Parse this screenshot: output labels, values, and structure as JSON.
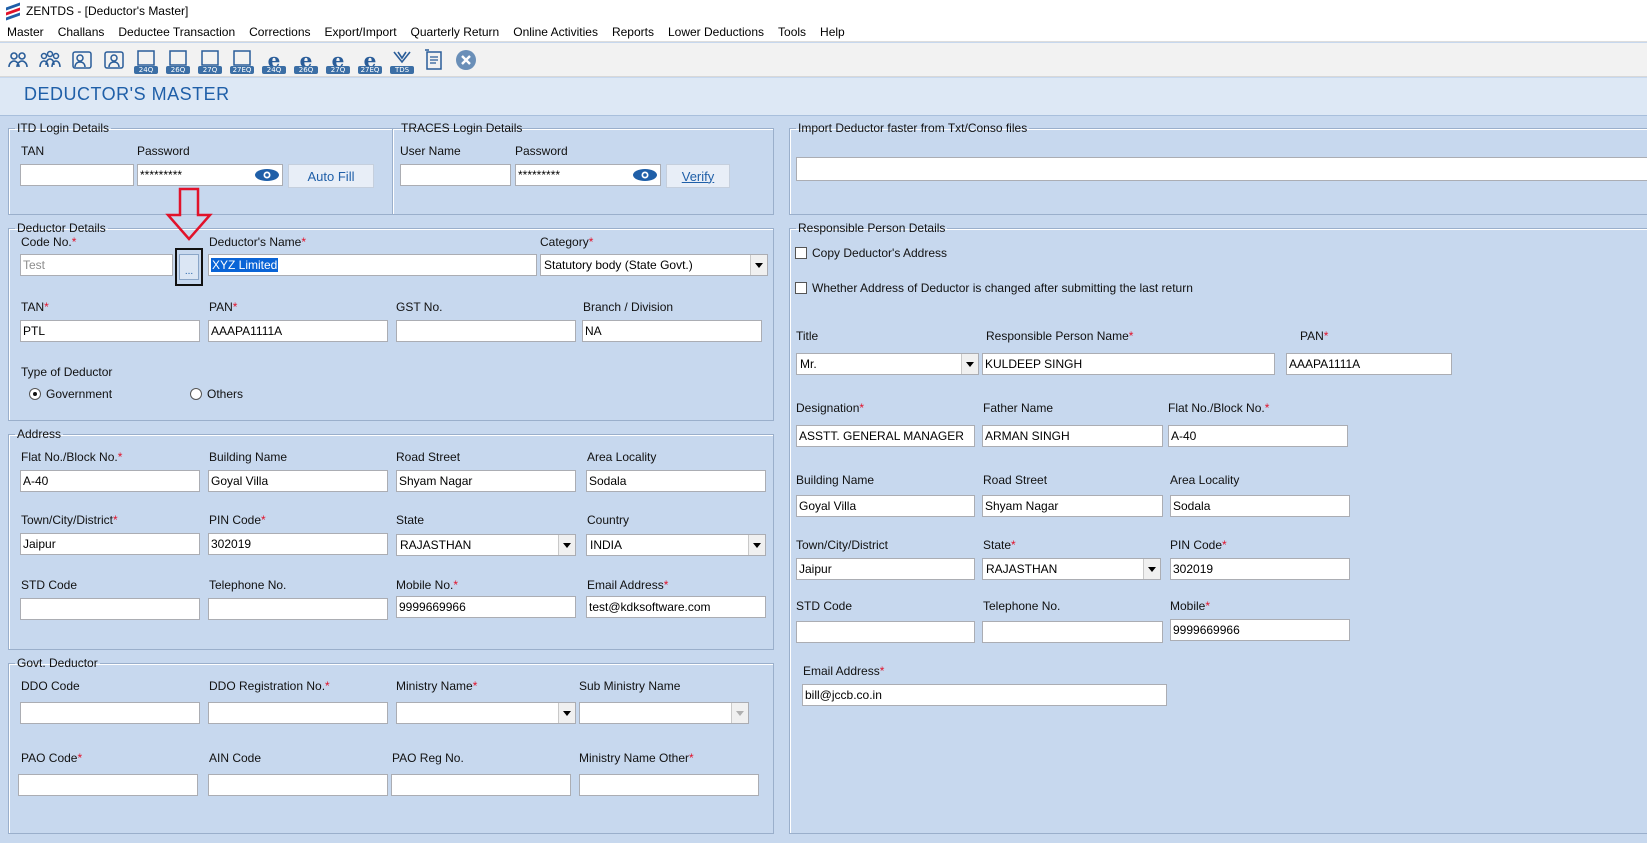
{
  "window": {
    "title": "ZENTDS - [Deductor's Master]"
  },
  "menu": [
    "Master",
    "Challans",
    "Deductee Transaction",
    "Corrections",
    "Export/Import",
    "Quarterly Return",
    "Online Activities",
    "Reports",
    "Lower Deductions",
    "Tools",
    "Help"
  ],
  "toolbar": {
    "icons": [
      "deductor-icon",
      "deductee-icon",
      "user-icon",
      "user2-icon",
      "24q-form-icon",
      "26q-form-icon",
      "27q-form-icon",
      "27eq-form-icon",
      "e-24q-icon",
      "e-26q-icon",
      "e-27q-icon",
      "e-27eq-icon",
      "tds-icon",
      "report-icon",
      "close-icon"
    ],
    "captions": [
      "",
      "",
      "",
      "",
      "24Q",
      "26Q",
      "27Q",
      "27EQ",
      "24Q",
      "26Q",
      "27Q",
      "27EQ",
      "TDS",
      "",
      ""
    ]
  },
  "page_title": "DEDUCTOR'S MASTER",
  "itd": {
    "legend": "ITD Login Details",
    "tan_label": "TAN",
    "tan_value": "",
    "password_label": "Password",
    "password_value": "*********",
    "autofill_label": "Auto Fill"
  },
  "traces": {
    "legend": "TRACES Login Details",
    "user_label": "User Name",
    "user_value": "",
    "password_label": "Password",
    "password_value": "*********",
    "verify_label": "Verify"
  },
  "import": {
    "legend": "Import Deductor faster from Txt/Conso files",
    "value": ""
  },
  "deductor": {
    "legend": "Deductor Details",
    "code_label": "Code No.",
    "code_value": "Test",
    "browse_label": "...",
    "name_label": "Deductor's Name",
    "name_value": "XYZ Limited",
    "category_label": "Category",
    "category_value": "Statutory body (State Govt.)",
    "tan_label": "TAN",
    "tan_value": "PTL",
    "pan_label": "PAN",
    "pan_value": "AAAPA1111A",
    "gst_label": "GST No.",
    "gst_value": "",
    "branch_label": "Branch / Division",
    "branch_value": "NA",
    "type_label": "Type of Deductor",
    "type_government": "Government",
    "type_others": "Others"
  },
  "address": {
    "legend": "Address",
    "flat_label": "Flat No./Block No.",
    "flat_value": "A-40",
    "building_label": "Building Name",
    "building_value": "Goyal Villa",
    "road_label": "Road Street",
    "road_value": "Shyam Nagar",
    "area_label": "Area Locality",
    "area_value": "Sodala",
    "town_label": "Town/City/District",
    "town_value": "Jaipur",
    "pin_label": "PIN Code",
    "pin_value": "302019",
    "state_label": "State",
    "state_value": "RAJASTHAN",
    "country_label": "Country",
    "country_value": "INDIA",
    "std_label": "STD Code",
    "std_value": "",
    "tel_label": "Telephone No.",
    "tel_value": "",
    "mobile_label": "Mobile No.",
    "mobile_value": "9999669966",
    "email_label": "Email Address",
    "email_value": "test@kdksoftware.com"
  },
  "govt": {
    "legend": "Govt. Deductor",
    "ddo_label": "DDO Code",
    "ddo_value": "",
    "ddoreg_label": "DDO Registration No.",
    "ddoreg_value": "",
    "ministry_label": "Ministry Name",
    "ministry_value": "",
    "subministry_label": "Sub Ministry Name",
    "subministry_value": "",
    "pao_label": "PAO Code",
    "pao_value": "",
    "ain_label": "AIN Code",
    "ain_value": "",
    "paoreg_label": "PAO Reg No.",
    "paoreg_value": "",
    "ministryother_label": "Ministry Name Other",
    "ministryother_value": ""
  },
  "responsible": {
    "legend": "Responsible Person Details",
    "copy_label": "Copy Deductor's Address",
    "changed_label": "Whether Address of Deductor is changed after submitting the last return",
    "title_label": "Title",
    "title_value": "Mr.",
    "name_label": "Responsible Person Name",
    "name_value": "KULDEEP SINGH",
    "pan_label": "PAN",
    "pan_value": "AAAPA1111A",
    "designation_label": "Designation",
    "designation_value": "ASSTT. GENERAL MANAGER",
    "father_label": "Father Name",
    "father_value": "ARMAN SINGH",
    "flat_label": "Flat No./Block No.",
    "flat_value": "A-40",
    "building_label": "Building Name",
    "building_value": "Goyal Villa",
    "road_label": "Road Street",
    "road_value": "Shyam Nagar",
    "area_label": "Area Locality",
    "area_value": "Sodala",
    "town_label": "Town/City/District",
    "town_value": "Jaipur",
    "state_label": "State",
    "state_value": "RAJASTHAN",
    "pin_label": "PIN Code",
    "pin_value": "302019",
    "std_label": "STD Code",
    "std_value": "",
    "tel_label": "Telephone No.",
    "tel_value": "",
    "mobile_label": "Mobile",
    "mobile_value": "9999669966",
    "email_label": "Email Address",
    "email_value": "bill@jccb.co.in"
  },
  "colors": {
    "required": "#e1122a",
    "header_text": "#1f5fa8",
    "panel_bg": "#c7d8ee",
    "annotation": "#e1122a"
  }
}
